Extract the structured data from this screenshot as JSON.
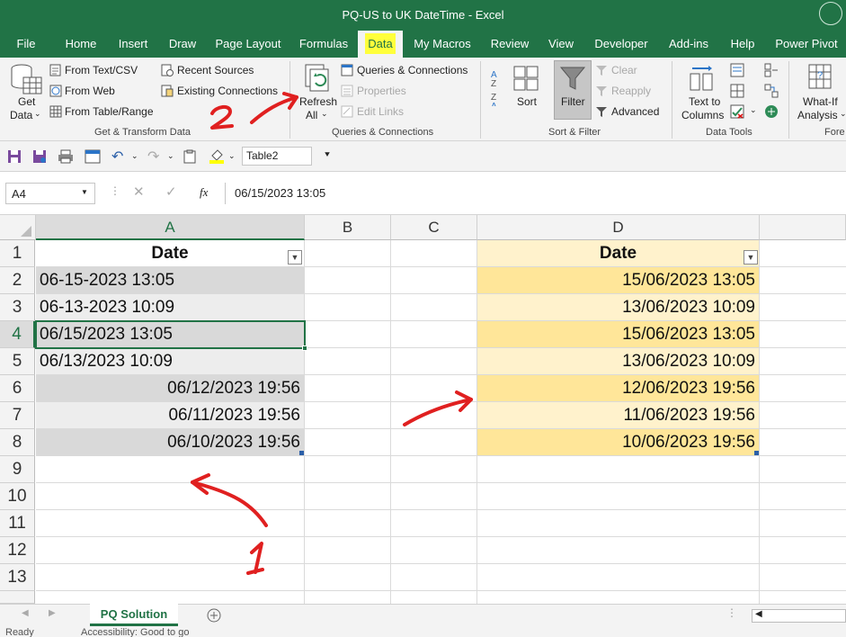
{
  "window": {
    "title": "PQ-US to UK DateTime  -  Excel"
  },
  "menu": {
    "tabs": [
      {
        "label": "File"
      },
      {
        "label": "Home"
      },
      {
        "label": "Insert"
      },
      {
        "label": "Draw"
      },
      {
        "label": "Page Layout"
      },
      {
        "label": "Formulas"
      },
      {
        "label": "Data"
      },
      {
        "label": "My Macros"
      },
      {
        "label": "Review"
      },
      {
        "label": "View"
      },
      {
        "label": "Developer"
      },
      {
        "label": "Add-ins"
      },
      {
        "label": "Help"
      },
      {
        "label": "Power Pivot"
      }
    ],
    "active": "Data"
  },
  "ribbon": {
    "get_transform": {
      "get_data_line1": "Get",
      "get_data_line2": "Data",
      "from_text_csv": "From Text/CSV",
      "from_web": "From Web",
      "from_table_range": "From Table/Range",
      "recent_sources": "Recent Sources",
      "existing_connections": "Existing Connections",
      "group_label": "Get & Transform Data"
    },
    "queries": {
      "refresh_line1": "Refresh",
      "refresh_line2": "All",
      "queries_connections": "Queries & Connections",
      "properties": "Properties",
      "edit_links": "Edit Links",
      "group_label": "Queries & Connections"
    },
    "sort_filter": {
      "sort": "Sort",
      "filter": "Filter",
      "clear": "Clear",
      "reapply": "Reapply",
      "advanced": "Advanced",
      "group_label": "Sort & Filter"
    },
    "data_tools": {
      "text_to_line1": "Text to",
      "text_to_line2": "Columns",
      "group_label": "Data Tools"
    },
    "forecast": {
      "what_if_line1": "What-If",
      "what_if_line2": "Analysis",
      "group_label": "Fore"
    }
  },
  "qat": {
    "table_name": "Table2"
  },
  "formula_bar": {
    "name_box": "A4",
    "formula": "06/15/2023 13:05",
    "fx": "fx"
  },
  "grid": {
    "columns": [
      "A",
      "B",
      "C",
      "D"
    ],
    "rows": [
      "1",
      "2",
      "3",
      "4",
      "5",
      "6",
      "7",
      "8",
      "9",
      "10",
      "11",
      "12",
      "13"
    ],
    "col_a": {
      "header": "Date",
      "values": [
        "06-15-2023 13:05",
        "06-13-2023 10:09",
        "06/15/2023 13:05",
        "06/13/2023 10:09",
        "06/12/2023 19:56",
        "06/11/2023 19:56",
        "06/10/2023 19:56"
      ]
    },
    "col_d": {
      "header": "Date",
      "values": [
        "15/06/2023 13:05",
        "13/06/2023 10:09",
        "15/06/2023 13:05",
        "13/06/2023 10:09",
        "12/06/2023 19:56",
        "11/06/2023 19:56",
        "10/06/2023 19:56"
      ]
    }
  },
  "annotations": {
    "one": "1",
    "two": "2",
    "color": "#e02020"
  },
  "sheets": {
    "active": "PQ Solution"
  },
  "status": {
    "ready": "Ready",
    "accessibility": "Accessibility: Good to go"
  },
  "colors": {
    "excel_green": "#217346",
    "tab_highlight": "#ffff3b",
    "d_band_dark": "#ffe699",
    "d_band_light": "#fff2cc"
  }
}
